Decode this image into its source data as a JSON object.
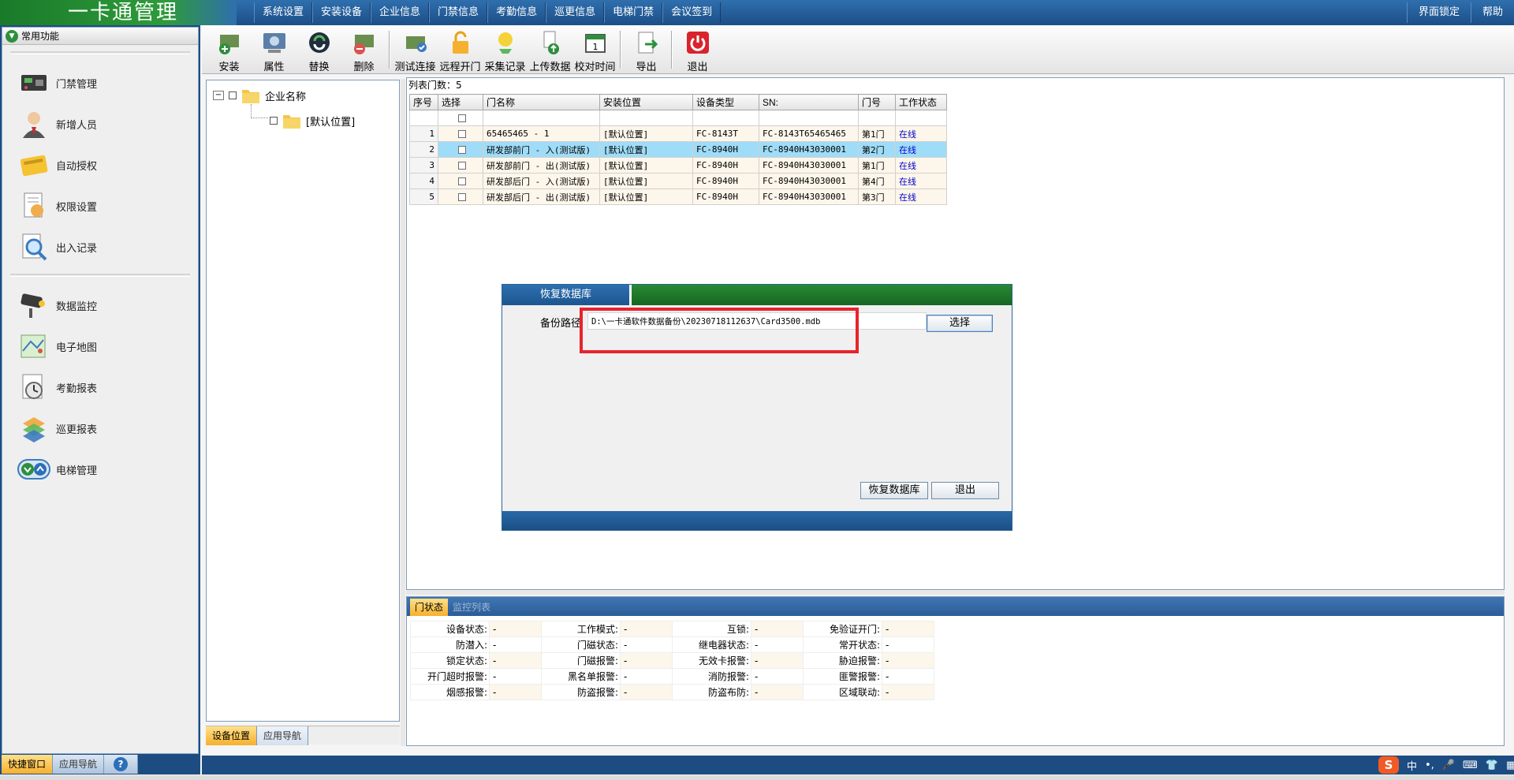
{
  "app": {
    "title": "一卡通管理"
  },
  "top_menu": [
    "系统设置",
    "安装设备",
    "企业信息",
    "门禁信息",
    "考勤信息",
    "巡更信息",
    "电梯门禁",
    "会议签到"
  ],
  "top_right": {
    "lock": "界面锁定",
    "help": "帮助"
  },
  "left_panel": {
    "header": "常用功能",
    "group1": [
      "门禁管理",
      "新增人员",
      "自动授权",
      "权限设置",
      "出入记录"
    ],
    "group2": [
      "数据监控",
      "电子地图",
      "考勤报表",
      "巡更报表",
      "电梯管理"
    ]
  },
  "left_bottom_tabs": [
    "快捷窗口",
    "应用导航"
  ],
  "toolbar": {
    "group1": [
      "安装",
      "属性",
      "替换",
      "删除"
    ],
    "group2": [
      "测试连接",
      "远程开门",
      "采集记录",
      "上传数据",
      "校对时间"
    ],
    "export": "导出",
    "exit": "退出"
  },
  "tree": {
    "root": "企业名称",
    "child": "[默认位置]"
  },
  "tree_tabs": [
    "设备位置",
    "应用导航"
  ],
  "grid": {
    "count_label": "列表门数：5",
    "headers": [
      "序号",
      "选择",
      "门名称",
      "安装位置",
      "设备类型",
      "SN:",
      "门号",
      "工作状态"
    ],
    "rows": [
      {
        "no": "1",
        "name": "65465465 - 1",
        "location": "[默认位置]",
        "type": "FC-8143T",
        "sn": "FC-8143T65465465",
        "door": "第1门",
        "status": "在线"
      },
      {
        "no": "2",
        "name": "研发部前门 - 入(测试版)",
        "location": "[默认位置]",
        "type": "FC-8940H",
        "sn": "FC-8940H43030001",
        "door": "第2门",
        "status": "在线"
      },
      {
        "no": "3",
        "name": "研发部前门 - 出(测试版)",
        "location": "[默认位置]",
        "type": "FC-8940H",
        "sn": "FC-8940H43030001",
        "door": "第1门",
        "status": "在线"
      },
      {
        "no": "4",
        "name": "研发部后门 - 入(测试版)",
        "location": "[默认位置]",
        "type": "FC-8940H",
        "sn": "FC-8940H43030001",
        "door": "第4门",
        "status": "在线"
      },
      {
        "no": "5",
        "name": "研发部后门 - 出(测试版)",
        "location": "[默认位置]",
        "type": "FC-8940H",
        "sn": "FC-8940H43030001",
        "door": "第3门",
        "status": "在线"
      }
    ],
    "selected_row": 1
  },
  "dialog": {
    "title": "恢复数据库",
    "path_label": "备份路径",
    "path_value": "D:\\一卡通软件数据备份\\20230718112637\\Card3500.mdb",
    "select_btn": "选择",
    "restore_btn": "恢复数据库",
    "exit_btn": "退出"
  },
  "status_tabs": [
    "门状态",
    "监控列表"
  ],
  "status_grid": [
    [
      [
        "设备状态:",
        "-"
      ],
      [
        "工作模式:",
        "-"
      ],
      [
        "互锁:",
        "-"
      ],
      [
        "免验证开门:",
        "-"
      ]
    ],
    [
      [
        "防潜入:",
        "-"
      ],
      [
        "门磁状态:",
        "-"
      ],
      [
        "继电器状态:",
        "-"
      ],
      [
        "常开状态:",
        "-"
      ]
    ],
    [
      [
        "锁定状态:",
        "-"
      ],
      [
        "门磁报警:",
        "-"
      ],
      [
        "无效卡报警:",
        "-"
      ],
      [
        "胁迫报警:",
        "-"
      ]
    ],
    [
      [
        "开门超时报警:",
        "-"
      ],
      [
        "黑名单报警:",
        "-"
      ],
      [
        "消防报警:",
        "-"
      ],
      [
        "匪警报警:",
        "-"
      ]
    ],
    [
      [
        "烟感报警:",
        "-"
      ],
      [
        "防盗报警:",
        "-"
      ],
      [
        "防盗布防:",
        "-"
      ],
      [
        "区域联动:",
        "-"
      ]
    ]
  ],
  "ime": {
    "logo": "S",
    "lang": "中",
    "punct": "•,"
  },
  "colors": {
    "top_bar": "#1c4f86",
    "title_green": "#2e9b3a",
    "highlight": "#e8232d",
    "online": "#0000cc",
    "selected_row": "#9fdcf7"
  }
}
